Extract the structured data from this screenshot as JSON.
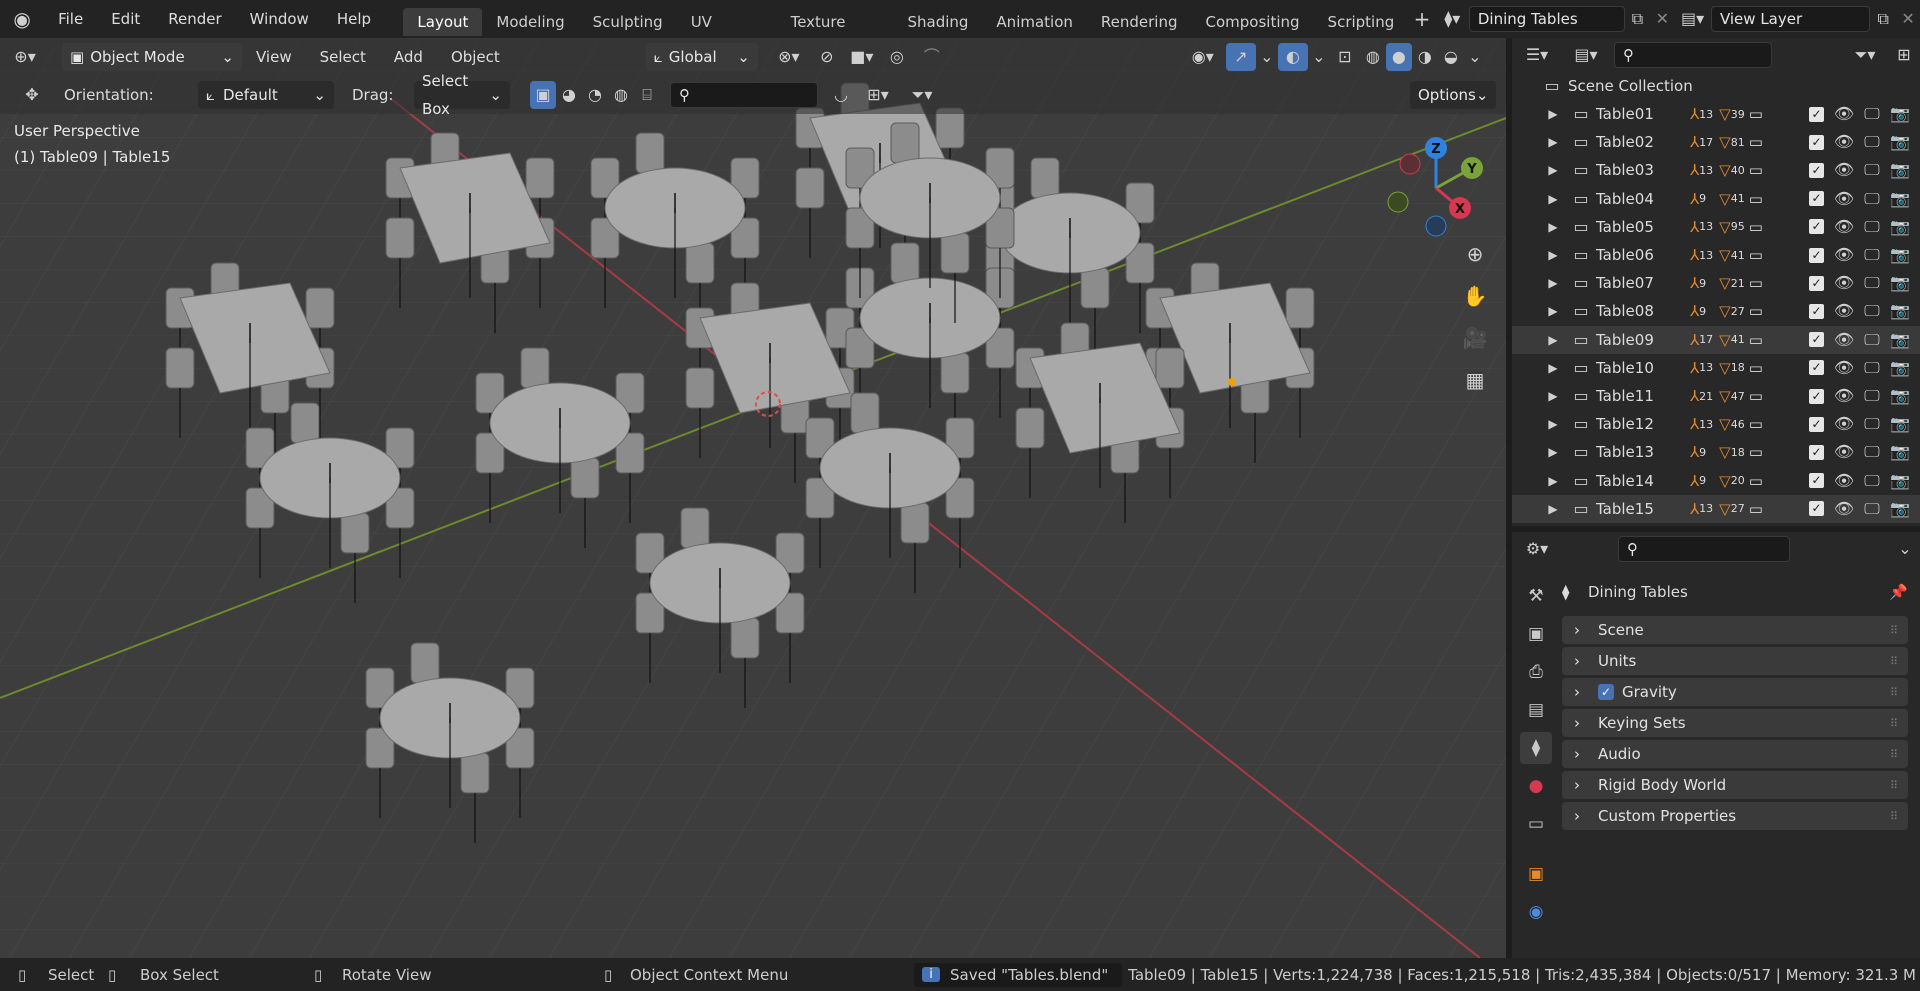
{
  "top_menu": [
    "File",
    "Edit",
    "Render",
    "Window",
    "Help"
  ],
  "workspaces": [
    "Layout",
    "Modeling",
    "Sculpting",
    "UV Editing",
    "Texture Paint",
    "Shading",
    "Animation",
    "Rendering",
    "Compositing",
    "Scripting"
  ],
  "scene_name": "Dining Tables",
  "view_layer": "View Layer",
  "header": {
    "mode": "Object Mode",
    "menus": [
      "View",
      "Select",
      "Add",
      "Object"
    ],
    "transform": "Global"
  },
  "tool_header": {
    "orientation_label": "Orientation:",
    "orientation_value": "Default",
    "drag_label": "Drag:",
    "drag_value": "Select Box",
    "options": "Options"
  },
  "overlay_text": {
    "perspective": "User Perspective",
    "selection": "(1) Table09 | Table15"
  },
  "outliner": {
    "collection": "Scene Collection",
    "rows": [
      {
        "name": "Table01",
        "a": "13",
        "b": "39"
      },
      {
        "name": "Table02",
        "a": "17",
        "b": "81"
      },
      {
        "name": "Table03",
        "a": "13",
        "b": "40"
      },
      {
        "name": "Table04",
        "a": "9",
        "b": "41"
      },
      {
        "name": "Table05",
        "a": "13",
        "b": "95"
      },
      {
        "name": "Table06",
        "a": "13",
        "b": "41"
      },
      {
        "name": "Table07",
        "a": "9",
        "b": "21"
      },
      {
        "name": "Table08",
        "a": "9",
        "b": "27"
      },
      {
        "name": "Table09",
        "a": "17",
        "b": "41"
      },
      {
        "name": "Table10",
        "a": "13",
        "b": "18"
      },
      {
        "name": "Table11",
        "a": "21",
        "b": "47"
      },
      {
        "name": "Table12",
        "a": "13",
        "b": "46"
      },
      {
        "name": "Table13",
        "a": "9",
        "b": "18"
      },
      {
        "name": "Table14",
        "a": "9",
        "b": "20"
      },
      {
        "name": "Table15",
        "a": "13",
        "b": "27"
      }
    ]
  },
  "properties": {
    "title": "Dining Tables",
    "panels": [
      "Scene",
      "Units",
      "Gravity",
      "Keying Sets",
      "Audio",
      "Rigid Body World",
      "Custom Properties"
    ]
  },
  "status": {
    "select": "Select",
    "box_select": "Box Select",
    "rotate": "Rotate View",
    "context": "Object Context Menu",
    "saved": "Saved \"Tables.blend\"",
    "stats": "Table09 | Table15 | Verts:1,224,738 | Faces:1,215,518 | Tris:2,435,384 | Objects:0/517 | Memory: 321.3 M"
  },
  "gizmo": {
    "x": "X",
    "y": "Y",
    "z": "Z"
  },
  "colors": {
    "accent": "#4772b3",
    "x_axis": "#d6384f",
    "y_axis": "#7aa33a",
    "z_axis": "#2f82e0"
  }
}
